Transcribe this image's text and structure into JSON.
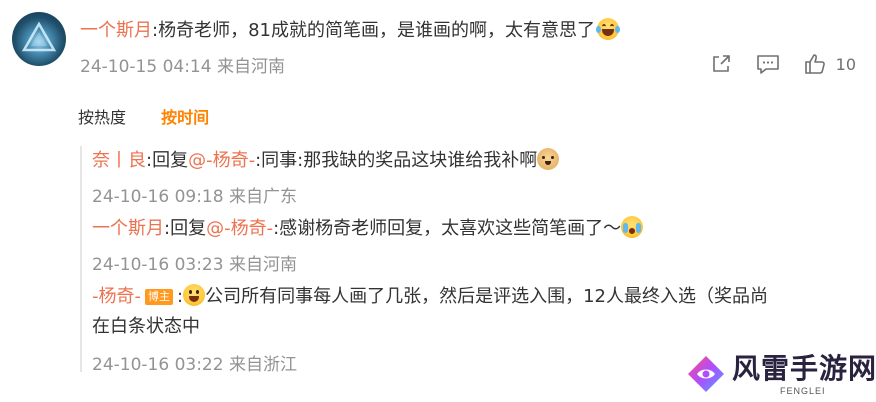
{
  "comment": {
    "author": "一个斯月",
    "text": ":杨奇老师，81成就的简笔画，是谁画的啊，太有意思了",
    "emoji": "grin-sweat-emoji",
    "time": "24-10-15 04:14",
    "location": "来自河南",
    "actions": {
      "share": "share-icon",
      "comment": "comment-icon",
      "like": "thumbs-up-icon",
      "like_count": "10"
    }
  },
  "sort": {
    "by_hot": "按热度",
    "by_time": "按时间"
  },
  "replies": [
    {
      "author": "奈丨良",
      "prefix": ":回复",
      "mention": "@-杨奇-",
      "text": ":同事:那我缺的奖品这块谁给我补啊",
      "emoji": "dog-emoji",
      "time": "24-10-16 09:18",
      "location": "来自广东"
    },
    {
      "author": "一个斯月",
      "prefix": ":回复",
      "mention": "@-杨奇-",
      "text": ":感谢杨奇老师回复，太喜欢这些简笔画了～",
      "emoji": "crying-emoji",
      "time": "24-10-16 03:23",
      "location": "来自河南"
    },
    {
      "author": "-杨奇-",
      "badge": "博主",
      "prefix": ":",
      "emoji": "surprised-emoji",
      "text": "公司所有同事每人画了几张，然后是评选入围，12人最终入选（奖品尚",
      "text_line2": "在白条状态中",
      "time": "24-10-16 03:22",
      "location": "来自浙江"
    }
  ],
  "watermark": {
    "name": "风雷手游网",
    "sub": "FENGLEI"
  },
  "colors": {
    "username": "#eb7350",
    "active_sort": "#ff8200",
    "meta": "#939393",
    "badge": "#ff9a1f"
  }
}
